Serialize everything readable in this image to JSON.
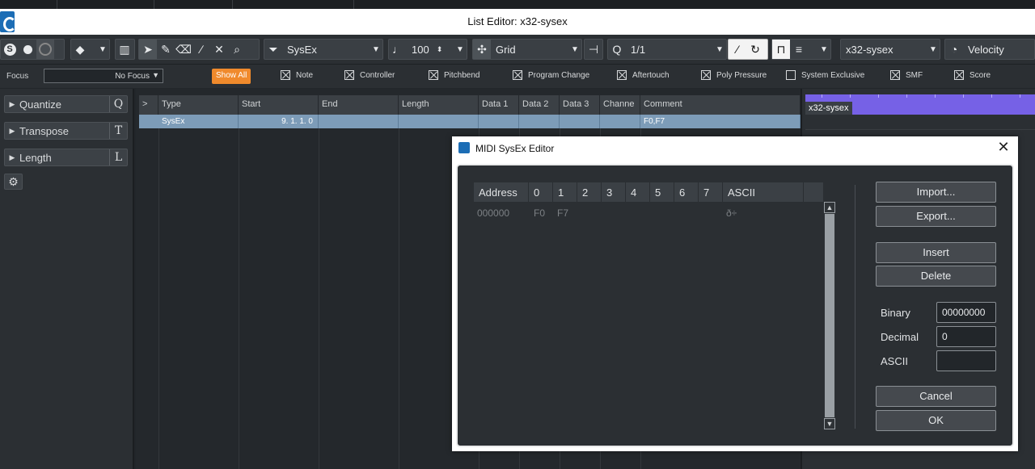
{
  "window": {
    "title": "List Editor: x32-sysex"
  },
  "toolbar": {
    "event_type": "SysEx",
    "velocity_value": "100",
    "snap_mode": "Grid",
    "quantize_value": "1/1",
    "track_name": "x32-sysex",
    "lane_mode": "Velocity"
  },
  "filterbar": {
    "focus_label": "Focus",
    "focus_value": "No Focus",
    "show_all": "Show All",
    "filters": [
      {
        "label": "Note",
        "checked": true
      },
      {
        "label": "Controller",
        "checked": true
      },
      {
        "label": "Pitchbend",
        "checked": true
      },
      {
        "label": "Program Change",
        "checked": true
      },
      {
        "label": "Aftertouch",
        "checked": true
      },
      {
        "label": "Poly Pressure",
        "checked": true
      },
      {
        "label": "System Exclusive",
        "checked": false
      },
      {
        "label": "SMF",
        "checked": true
      },
      {
        "label": "Score",
        "checked": true
      }
    ]
  },
  "inspector": {
    "sections": [
      {
        "label": "Quantize",
        "key": "Q"
      },
      {
        "label": "Transpose",
        "key": "T"
      },
      {
        "label": "Length",
        "key": "L"
      }
    ]
  },
  "list": {
    "expand": ">",
    "columns": [
      "Type",
      "Start",
      "End",
      "Length",
      "Data 1",
      "Data 2",
      "Data 3",
      "Channe",
      "Comment"
    ],
    "rows": [
      {
        "type": "SysEx",
        "start": "9.  1.  1.    0",
        "end": "",
        "length": "",
        "data1": "",
        "data2": "",
        "data3": "",
        "channel": "",
        "comment": "F0,F7"
      }
    ]
  },
  "lane": {
    "part_name": "x32-sysex"
  },
  "sysex_dialog": {
    "title": "MIDI SysEx Editor",
    "columns": [
      "Address",
      "0",
      "1",
      "2",
      "3",
      "4",
      "5",
      "6",
      "7",
      "ASCII"
    ],
    "row": {
      "address": "000000",
      "b0": "F0",
      "b1": "F7",
      "ascii": "ð÷"
    },
    "buttons": {
      "import": "Import...",
      "export": "Export...",
      "insert": "Insert",
      "delete": "Delete",
      "cancel": "Cancel",
      "ok": "OK"
    },
    "fields": {
      "binary_label": "Binary",
      "binary_value": "00000000",
      "decimal_label": "Decimal",
      "decimal_value": "0",
      "ascii_label": "ASCII",
      "ascii_value": ""
    }
  }
}
